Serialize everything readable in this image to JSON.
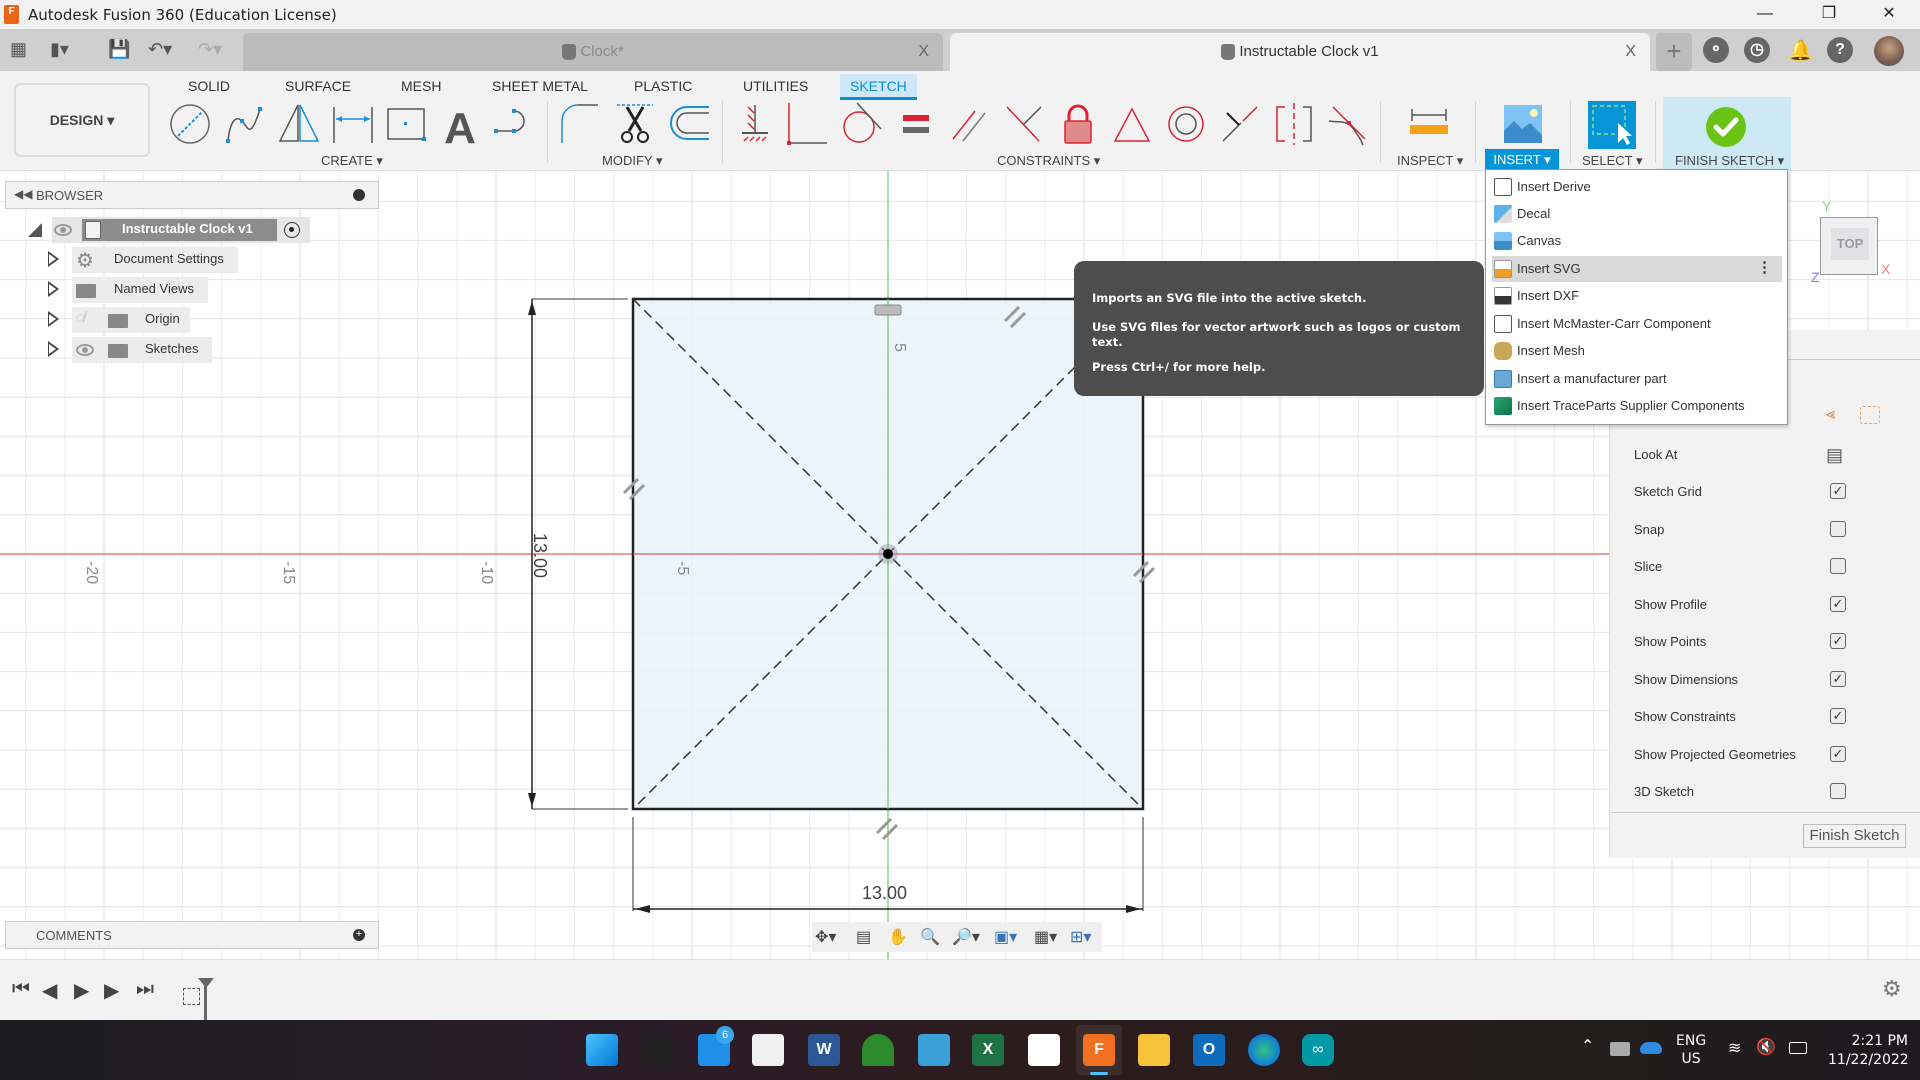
{
  "window": {
    "title": "Autodesk Fusion 360 (Education License)",
    "controls": [
      "minimize",
      "restore",
      "close"
    ]
  },
  "quick_access": {
    "icons": [
      "apps-grid-icon",
      "file-icon",
      "save-icon",
      "undo-icon",
      "redo-icon"
    ]
  },
  "doc_tabs": [
    {
      "name": "Clock*",
      "active": false,
      "close": "X"
    },
    {
      "name": "Instructable Clock v1",
      "active": true,
      "close": "X"
    }
  ],
  "header_right_icons": [
    "new-tab-icon",
    "extensions-icon",
    "job-status-icon",
    "notifications-icon",
    "help-icon",
    "user-avatar"
  ],
  "ribbon": {
    "workspace": "DESIGN",
    "tabs": [
      "SOLID",
      "SURFACE",
      "MESH",
      "SHEET METAL",
      "PLASTIC",
      "UTILITIES",
      "SKETCH"
    ],
    "active_tab": "SKETCH",
    "groups": {
      "create": "CREATE",
      "modify": "MODIFY",
      "constraints": "CONSTRAINTS",
      "inspect": "INSPECT",
      "insert": "INSERT",
      "select": "SELECT",
      "finish": "FINISH SKETCH"
    },
    "create_tools": [
      "circle-tool",
      "spline-tool",
      "triangle-tool",
      "dimension-tool",
      "rectangle-tool",
      "text-tool",
      "slot-tool"
    ],
    "modify_tools": [
      "fillet-tool",
      "trim-tool",
      "offset-tool"
    ],
    "constraint_tools": [
      "fix-constraint",
      "coincident-constraint",
      "tangent-constraint",
      "equal-constraint",
      "parallel-constraint",
      "perpendicular-constraint",
      "lock-constraint",
      "midpoint-constraint",
      "concentric-constraint",
      "collinear-constraint",
      "symmetry-constraint",
      "curvature-constraint"
    ]
  },
  "browser": {
    "title": "BROWSER",
    "root": "Instructable Clock v1",
    "items": [
      {
        "label": "Document Settings",
        "icon": "gear-icon"
      },
      {
        "label": "Named Views",
        "icon": "folder-icon"
      },
      {
        "label": "Origin",
        "icon": "folder-icon",
        "visible": false
      },
      {
        "label": "Sketches",
        "icon": "folder-icon",
        "visible": true
      }
    ]
  },
  "comments": {
    "title": "COMMENTS"
  },
  "insert_menu": {
    "items": [
      {
        "label": "Insert Derive",
        "highlighted": false
      },
      {
        "label": "Decal",
        "highlighted": false
      },
      {
        "label": "Canvas",
        "highlighted": false
      },
      {
        "label": "Insert SVG",
        "highlighted": true
      },
      {
        "label": "Insert DXF",
        "highlighted": false
      },
      {
        "label": "Insert McMaster-Carr Component",
        "highlighted": false
      },
      {
        "label": "Insert Mesh",
        "highlighted": false
      },
      {
        "label": "Insert a manufacturer part",
        "highlighted": false
      },
      {
        "label": "Insert TraceParts Supplier Components",
        "highlighted": false
      }
    ],
    "more_glyph": "⋮"
  },
  "tooltip": {
    "line1": "Imports an SVG file into the active sketch.",
    "line2": "Use SVG files for vector artwork such as logos or custom text.",
    "line3": "Press Ctrl+/ for more help."
  },
  "sketch_palette": {
    "look_at": "Look At",
    "options": [
      {
        "label": "Sketch Grid",
        "checked": true
      },
      {
        "label": "Snap",
        "checked": false
      },
      {
        "label": "Slice",
        "checked": false
      },
      {
        "label": "Show Profile",
        "checked": true
      },
      {
        "label": "Show Points",
        "checked": true
      },
      {
        "label": "Show Dimensions",
        "checked": true
      },
      {
        "label": "Show Constraints",
        "checked": true
      },
      {
        "label": "Show Projected Geometries",
        "checked": true
      },
      {
        "label": "3D Sketch",
        "checked": false
      }
    ],
    "finish_button": "Finish Sketch"
  },
  "viewcube": {
    "face": "TOP",
    "axes": {
      "x": "X",
      "y": "Y",
      "z": "Z"
    }
  },
  "sketch": {
    "width_dimension": "13.00",
    "height_dimension": "13.00",
    "axis_labels": {
      "x": [
        "-20",
        "-15",
        "-10",
        "-5"
      ],
      "y": [
        "5"
      ]
    }
  },
  "navbar_icons": [
    "orbit-icon",
    "look-at-icon",
    "pan-icon",
    "zoom-icon",
    "fit-icon",
    "display-settings-icon",
    "grid-icon",
    "viewports-icon"
  ],
  "timeline": {
    "controls": [
      "first-icon",
      "previous-icon",
      "play-icon",
      "next-icon",
      "last-icon"
    ]
  },
  "taskbar": {
    "apps": [
      "start",
      "inkscape",
      "mail",
      "snipping-tool",
      "word",
      "geogebra",
      "kindle",
      "excel",
      "notepad",
      "fusion-360",
      "file-explorer",
      "outlook",
      "edge",
      "arduino"
    ],
    "mail_badge": "6",
    "tray": {
      "lang1": "ENG",
      "lang2": "US",
      "time": "2:21 PM",
      "date": "11/22/2022"
    }
  }
}
